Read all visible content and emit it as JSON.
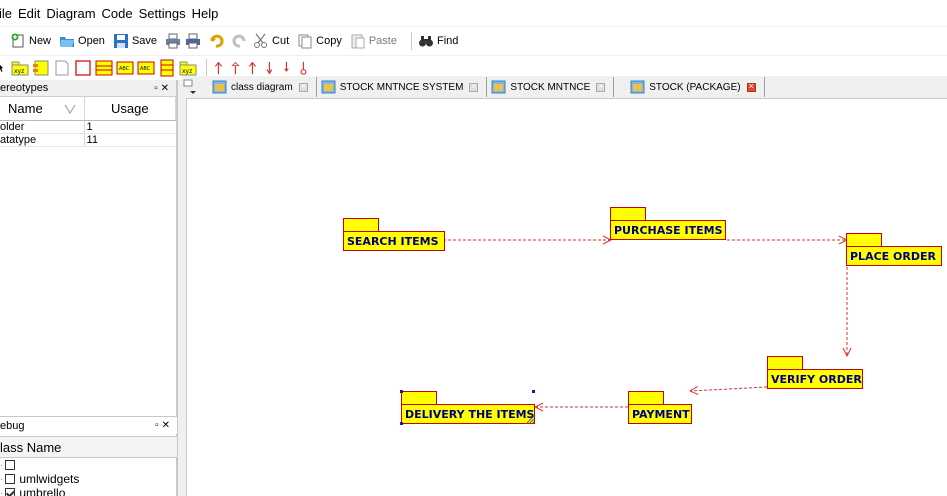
{
  "menubar": {
    "items": [
      "ile",
      "Edit",
      "Diagram",
      "Code",
      "Settings",
      "Help"
    ]
  },
  "toolbar": {
    "new_label": "New",
    "open_label": "Open",
    "save_label": "Save",
    "cut_label": "Cut",
    "copy_label": "Copy",
    "paste_label": "Paste",
    "find_label": "Find"
  },
  "stereotypes": {
    "title": "ereotypes",
    "col_name": "Name",
    "col_usage": "Usage",
    "rows": [
      {
        "name": "older",
        "usage": "1"
      },
      {
        "name": "atatype",
        "usage": "11"
      }
    ]
  },
  "debug": {
    "title": "ebug",
    "col_class": "lass Name",
    "rows": [
      {
        "label": "",
        "checked": false
      },
      {
        "label": "umlwidgets",
        "checked": false
      },
      {
        "label": "umbrello",
        "checked": true
      }
    ]
  },
  "tabs": [
    {
      "label": "class diagram",
      "active": false
    },
    {
      "label": "STOCK MNTNCE SYSTEM",
      "active": false
    },
    {
      "label": "STOCK MNTNCE",
      "active": false
    },
    {
      "label": "STOCK (PACKAGE)",
      "active": true
    }
  ],
  "diagram": {
    "packages": [
      {
        "id": "search",
        "label": "SEARCH ITEMS"
      },
      {
        "id": "purchase",
        "label": "PURCHASE ITEMS"
      },
      {
        "id": "place",
        "label": "PLACE ORDER"
      },
      {
        "id": "verify",
        "label": "VERIFY ORDER"
      },
      {
        "id": "payment",
        "label": "PAYMENT"
      },
      {
        "id": "delivery",
        "label": "DELIVERY THE ITEMS"
      }
    ],
    "flow": [
      [
        "search",
        "purchase"
      ],
      [
        "purchase",
        "place"
      ],
      [
        "place",
        "verify"
      ],
      [
        "verify",
        "payment"
      ],
      [
        "payment",
        "delivery"
      ]
    ],
    "colors": {
      "package_fill": "#ffff00",
      "package_border": "#cc0000",
      "label_text": "#000080",
      "arrow": "#e03030"
    }
  }
}
